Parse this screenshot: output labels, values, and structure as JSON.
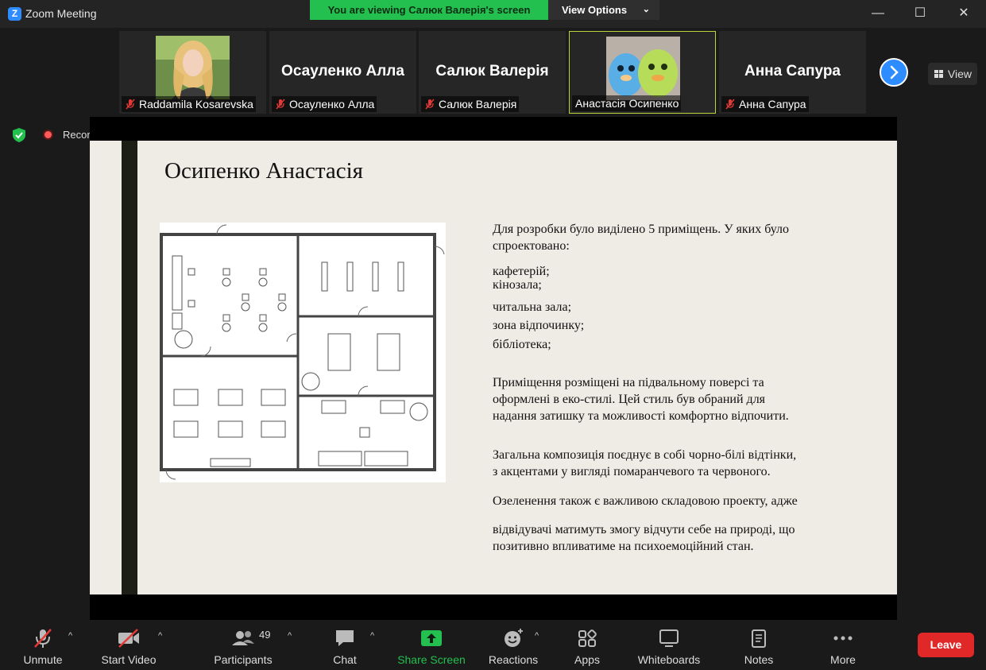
{
  "window": {
    "app_title": "Zoom Meeting",
    "minimize": "—",
    "maximize": "☐",
    "close": "✕"
  },
  "banner": {
    "viewing": "You are viewing Салюк Валерія's screen",
    "view_options": "View Options"
  },
  "participants_strip": [
    {
      "name": "Raddamila Kosarevska",
      "display": "photo",
      "muted": true
    },
    {
      "name": "Осауленко Алла",
      "display": "name",
      "muted": true
    },
    {
      "name": "Салюк Валерія",
      "display": "name",
      "muted": true
    },
    {
      "name": "Анастасія Осипенко",
      "display": "photo",
      "muted": false,
      "active": true
    },
    {
      "name": "Анна Сапура",
      "display": "name",
      "muted": true
    }
  ],
  "view_button": "View",
  "status": {
    "recording": "Recording"
  },
  "slide": {
    "title": "Осипенко Анастасія",
    "intro": "Для розробки було виділено 5 приміщень. У яких було спроектовано:",
    "rooms": [
      "кафетерій;",
      "кінозала;",
      "читальна зала;",
      "зона відпочинку;",
      "бібліотека;"
    ],
    "paragraph1": "Приміщення розміщені на підвальному поверсі та оформлені в еко-стилі. Цей стиль був обраний для надання затишку та можливості комфортно відпочити.",
    "paragraph2": "Загальна композиція поєднує в собі чорно-білі відтінки, з акцентами у вигляді помаранчевого та червоного.",
    "paragraph3_a": "Озеленення також є важливою складовою проекту, адже",
    "paragraph3_b": "відвідувачі матимуть змогу відчути себе на природі, що позитивно впливатиме на психоемоційний стан."
  },
  "toolbar": {
    "unmute": "Unmute",
    "start_video": "Start Video",
    "participants": "Participants",
    "participants_count": "49",
    "chat": "Chat",
    "share_screen": "Share Screen",
    "reactions": "Reactions",
    "apps": "Apps",
    "whiteboards": "Whiteboards",
    "notes": "Notes",
    "more": "More",
    "leave": "Leave"
  },
  "colors": {
    "accent_green": "#23c04f",
    "accent_blue": "#2d8cff",
    "leave_red": "#e02828",
    "slide_bg": "#efebe5"
  }
}
